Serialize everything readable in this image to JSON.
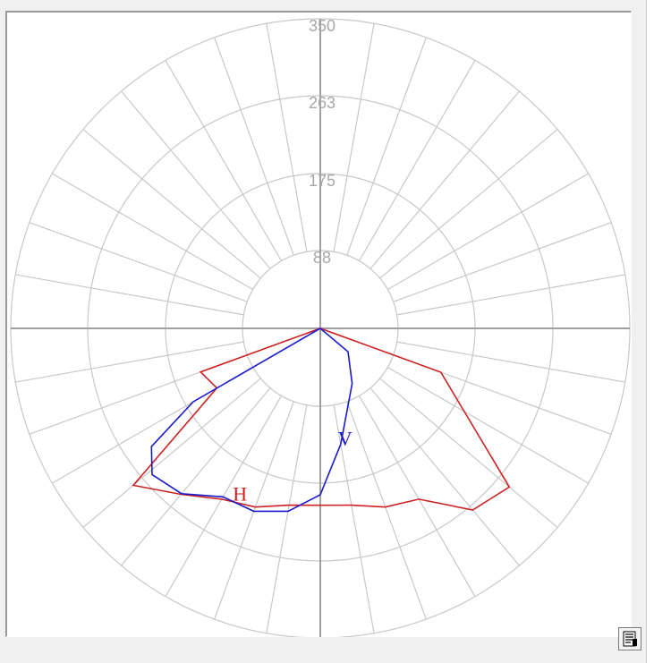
{
  "chart_data": {
    "type": "polar",
    "radial_ticks": [
      88,
      175,
      263,
      350
    ],
    "rmax": 350,
    "angle_step_deg": 10,
    "grid": true,
    "colors": {
      "grid": "#c8c8c8",
      "axis": "#a0a0a0",
      "red": "#cc2222",
      "blue": "#1a1acc"
    },
    "series": [
      {
        "label": "H",
        "color": "#cc2222",
        "points": [
          {
            "angle": 0,
            "r": 0
          },
          {
            "angle": 70,
            "r": 145
          },
          {
            "angle": 50,
            "r": 279
          },
          {
            "angle": 40,
            "r": 268
          },
          {
            "angle": 30,
            "r": 223
          },
          {
            "angle": 20,
            "r": 215
          },
          {
            "angle": 10,
            "r": 203
          },
          {
            "angle": 0,
            "r": 200
          },
          {
            "angle": -10,
            "r": 203
          },
          {
            "angle": -20,
            "r": 215
          },
          {
            "angle": -30,
            "r": 223
          },
          {
            "angle": -40,
            "r": 245
          },
          {
            "angle": -50,
            "r": 276
          },
          {
            "angle": -60,
            "r": 135
          },
          {
            "angle": -70,
            "r": 144
          },
          {
            "angle": 0,
            "r": 0
          }
        ]
      },
      {
        "label": "V",
        "color": "#1a1acc",
        "points": [
          {
            "angle": 0,
            "r": 0
          },
          {
            "angle": 50,
            "r": 41
          },
          {
            "angle": 30,
            "r": 72
          },
          {
            "angle": 18,
            "r": 98
          },
          {
            "angle": 10,
            "r": 133
          },
          {
            "angle": 0,
            "r": 188
          },
          {
            "angle": -10,
            "r": 210
          },
          {
            "angle": -20,
            "r": 220
          },
          {
            "angle": -30,
            "r": 220
          },
          {
            "angle": -40,
            "r": 244
          },
          {
            "angle": -49,
            "r": 252
          },
          {
            "angle": -55,
            "r": 233
          },
          {
            "angle": -60,
            "r": 166
          },
          {
            "angle": 0,
            "r": 0
          }
        ]
      }
    ]
  },
  "ui": {
    "report_icon": "report-document-icon"
  }
}
